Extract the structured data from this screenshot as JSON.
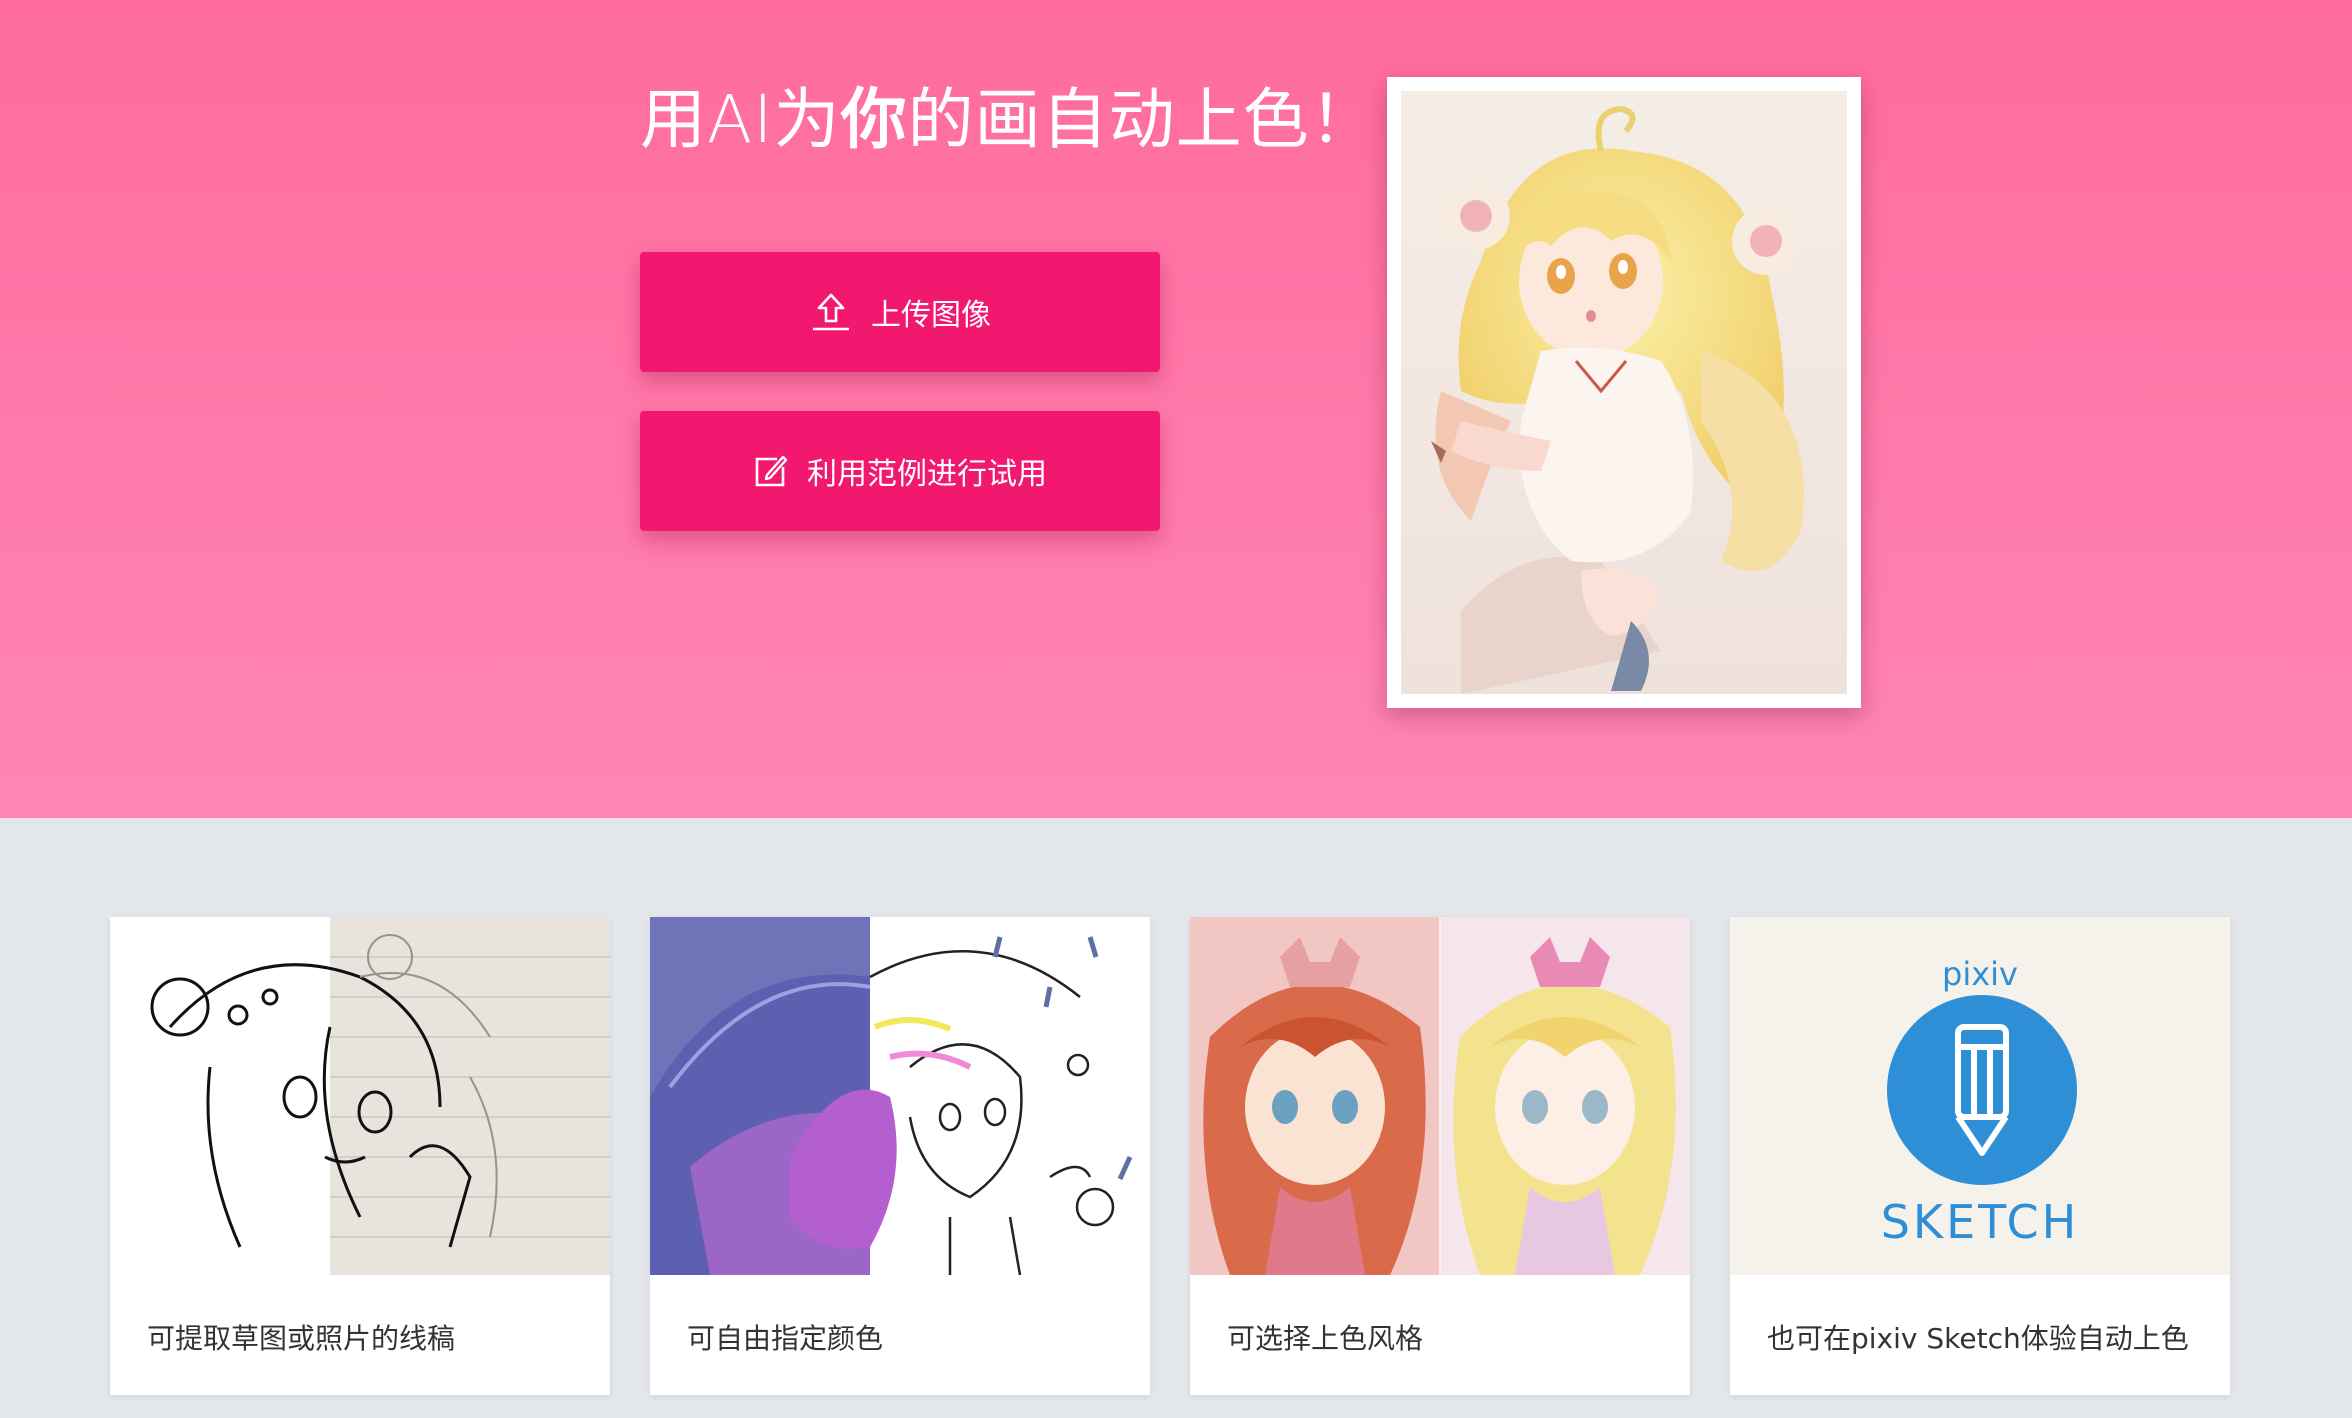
{
  "hero": {
    "title_before": "用AI为",
    "title_emphasis": "你",
    "title_after": "的画自动上色！",
    "upload_button_label": "上传图像",
    "sample_button_label": "利用范例进行试用"
  },
  "features": [
    {
      "caption": "可提取草图或照片的线稿"
    },
    {
      "caption": "可自由指定颜色"
    },
    {
      "caption": "可选择上色风格"
    },
    {
      "caption": "也可在pixiv Sketch体验自动上色",
      "logo_top": "pixiv",
      "logo_bottom": "SKETCH"
    }
  ],
  "colors": {
    "hero_top": "#ff6b9e",
    "hero_bottom": "#ff86b4",
    "button": "#f3186f",
    "page_bg": "#e3e6ea",
    "pixiv_blue": "#2f8fd6"
  },
  "icons": {
    "upload": "upload-icon",
    "edit": "edit-icon",
    "pencil": "pencil-icon"
  }
}
